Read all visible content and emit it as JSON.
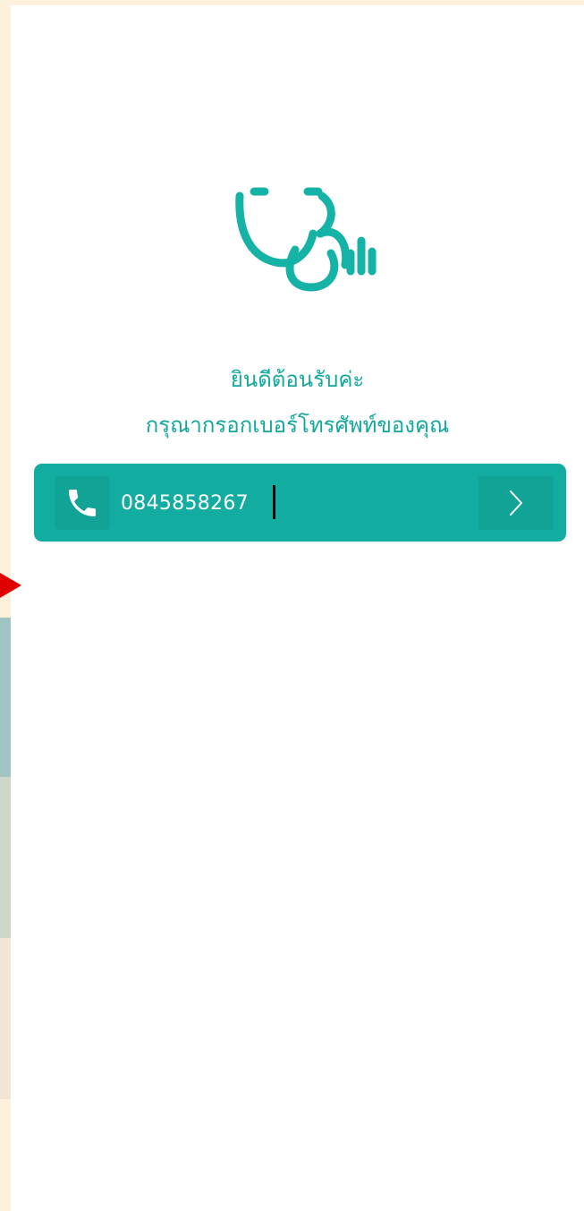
{
  "welcome": {
    "line1": "ยินดีต้อนรับค่ะ",
    "line2": "กรุณากรอกเบอร์โทรศัพท์ของคุณ"
  },
  "phone_field": {
    "value": "0845858267",
    "icon": "phone-icon"
  },
  "next_button": {
    "icon": "chevron-right-icon"
  },
  "logo": {
    "icon": "stethoscope-logo-icon"
  },
  "colors": {
    "accent": "#12ada0",
    "accent_dark": "#10a396",
    "background_outer": "#fdf0dc",
    "marker": "#e00000"
  }
}
